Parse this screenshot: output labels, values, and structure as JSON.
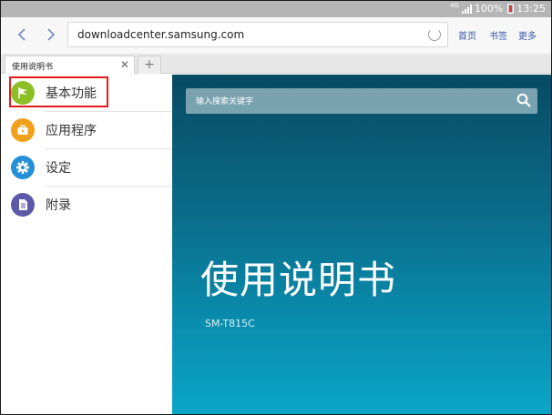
{
  "status_bar": {
    "network": "4G",
    "battery": "100%",
    "time": "13:25"
  },
  "toolbar": {
    "url": "downloadcenter.samsung.com",
    "home": "首页",
    "bookmarks": "书签",
    "more": "更多"
  },
  "tabs": [
    {
      "title": "使用说明书"
    }
  ],
  "sidebar": {
    "items": [
      {
        "label": "基本功能",
        "icon": "flag-icon",
        "color": "#8cbf26"
      },
      {
        "label": "应用程序",
        "icon": "toolbox-icon",
        "color": "#f0a01a"
      },
      {
        "label": "设定",
        "icon": "gear-icon",
        "color": "#2590d8"
      },
      {
        "label": "附录",
        "icon": "document-icon",
        "color": "#5c5aa8"
      }
    ]
  },
  "main": {
    "search_placeholder": "输入搜索关键字",
    "title": "使用说明书",
    "model": "SM-T815C"
  }
}
